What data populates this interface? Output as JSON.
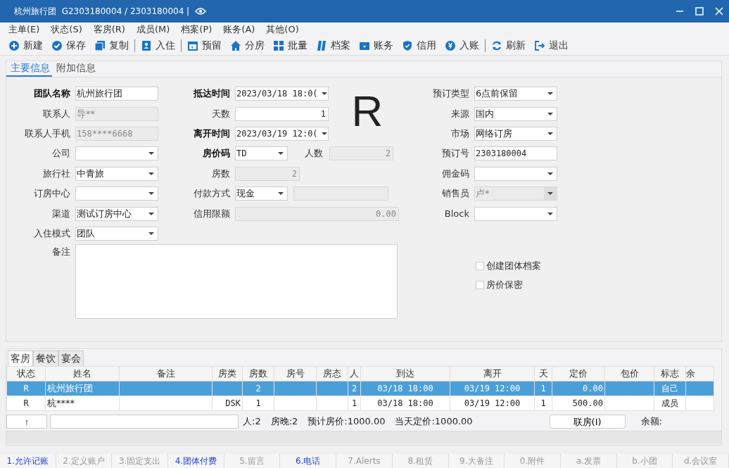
{
  "window": {
    "title": "杭州旅行团  G2303180004 / 2303180004 |"
  },
  "menu": [
    "主单(E)",
    "状态(S)",
    "客房(R)",
    "成员(M)",
    "档案(P)",
    "账务(A)",
    "其他(O)"
  ],
  "toolbar": [
    {
      "kind": "button",
      "label": "新建"
    },
    {
      "kind": "button",
      "label": "保存"
    },
    {
      "kind": "button",
      "label": "复制"
    },
    {
      "kind": "separator"
    },
    {
      "kind": "button",
      "label": "入住"
    },
    {
      "kind": "separator"
    },
    {
      "kind": "button",
      "label": "预留"
    },
    {
      "kind": "button",
      "label": "分房"
    },
    {
      "kind": "button",
      "label": "批量"
    },
    {
      "kind": "button",
      "label": "档案"
    },
    {
      "kind": "button",
      "label": "账务"
    },
    {
      "kind": "button",
      "label": "信用"
    },
    {
      "kind": "button",
      "label": "入账"
    },
    {
      "kind": "separator"
    },
    {
      "kind": "button",
      "label": "刷新"
    },
    {
      "kind": "button",
      "label": "退出"
    }
  ],
  "tabs": [
    {
      "label": "主要信息",
      "selected": true
    },
    {
      "label": "附加信息",
      "selected": false
    }
  ],
  "form": {
    "column_1": [
      {
        "label": "团队名称",
        "value": "杭州旅行团",
        "kind": "text",
        "required": true,
        "disabled": false
      },
      {
        "label": "联系人",
        "value": "导**",
        "kind": "text",
        "required": false,
        "disabled": true
      },
      {
        "label": "联系人手机",
        "value": "158****6668",
        "kind": "text",
        "required": false,
        "disabled": true
      },
      {
        "label": "公司",
        "kind": "select",
        "required": false,
        "disabled": false
      },
      {
        "label": "旅行社",
        "value": "中青旅",
        "kind": "select",
        "required": false,
        "disabled": false
      },
      {
        "label": "订房中心",
        "kind": "select",
        "required": false,
        "disabled": false
      },
      {
        "label": "渠道",
        "value": "测试订房中心",
        "kind": "select",
        "required": false,
        "disabled": false
      },
      {
        "label": "入住模式",
        "value": "团队",
        "kind": "select",
        "required": false,
        "disabled": false
      }
    ],
    "column_2": [
      {
        "label": "抵达时间",
        "value": "2023/03/18 18:0(",
        "kind": "select",
        "required": true,
        "disabled": false
      },
      {
        "label": "天数",
        "value": "1",
        "kind": "number",
        "required": false,
        "disabled": false
      },
      {
        "label": "离开时间",
        "value": "2023/03/19 12:0(",
        "kind": "select",
        "required": true,
        "disabled": false
      },
      {
        "label": "房价码",
        "value": "TD",
        "kind": "select",
        "required": true,
        "disabled": false,
        "extra": {
          "label": "人数",
          "value": "2",
          "kind": "number",
          "disabled": true
        }
      },
      {
        "label": "房数",
        "value": "2",
        "kind": "number",
        "required": false,
        "disabled": true
      },
      {
        "label": "付款方式",
        "value": "现金",
        "kind": "select",
        "required": false,
        "disabled": false,
        "extra": {
          "kind": "text",
          "disabled": true
        }
      },
      {
        "label": "信用限额",
        "value": "0.00",
        "kind": "number",
        "required": false,
        "disabled": true
      }
    ],
    "status_letter": "R",
    "column_3": [
      {
        "label": "预订类型",
        "value": "6点前保留",
        "kind": "select",
        "required": false,
        "disabled": false
      },
      {
        "label": "来源",
        "value": "国内",
        "kind": "select",
        "required": false,
        "disabled": false
      },
      {
        "label": "市场",
        "value": "网络订房",
        "kind": "select",
        "required": false,
        "disabled": false
      },
      {
        "label": "预订号",
        "value": "2303180004",
        "kind": "text",
        "required": false,
        "disabled": false
      },
      {
        "label": "佣金码",
        "kind": "select",
        "required": false,
        "disabled": false
      },
      {
        "label": "销售员",
        "value": "卢*",
        "kind": "select",
        "required": false,
        "disabled": true
      },
      {
        "label": "Block",
        "kind": "select",
        "required": false,
        "disabled": false
      }
    ],
    "remarks": {
      "label": "备注"
    },
    "checkboxes": [
      {
        "label": "创建团体档案",
        "checked": false
      },
      {
        "label": "房价保密",
        "checked": false
      }
    ]
  },
  "bottom_tabs": [
    {
      "label": "客房",
      "selected": true
    },
    {
      "label": "餐饮",
      "selected": false
    },
    {
      "label": "宴会",
      "selected": false
    }
  ],
  "table": {
    "columns": [
      "状态",
      "姓名",
      "备注",
      "房类",
      "房数",
      "房号",
      "房态",
      "人",
      "到达",
      "离开",
      "天",
      "定价",
      "包价",
      "标志",
      "余"
    ],
    "rows": [
      {
        "selected": true,
        "cells": [
          "R",
          "杭州旅行团",
          "",
          "",
          "2",
          "",
          "",
          "2",
          "03/18 18:00",
          "03/19 12:00",
          "1",
          "0.00",
          "",
          "自己",
          ""
        ]
      },
      {
        "selected": false,
        "cells": [
          "R",
          "杭****",
          "",
          "DSK",
          "1",
          "",
          "",
          "1",
          "03/18 18:00",
          "03/19 12:00",
          "1",
          "500.00",
          "",
          "成员",
          ""
        ]
      }
    ]
  },
  "footer": {
    "up_button": "↑",
    "summary": [
      "人:2",
      "房晚:2",
      "预计房价:1000.00",
      "当天定价:1000.00"
    ],
    "link_button": "联房(I)",
    "balance_label": "余额:"
  },
  "function_bar": [
    {
      "label": "1.允许记账",
      "enabled": true
    },
    {
      "label": "2.定义账户",
      "enabled": false
    },
    {
      "label": "3.固定支出",
      "enabled": false
    },
    {
      "label": "4.团体付费",
      "enabled": true
    },
    {
      "label": "5.留言",
      "enabled": false
    },
    {
      "label": "6.电话",
      "enabled": true
    },
    {
      "label": "7.Alerts",
      "enabled": false
    },
    {
      "label": "8.租赁",
      "enabled": false
    },
    {
      "label": "9.大备注",
      "enabled": false
    },
    {
      "label": "0.附件",
      "enabled": false
    },
    {
      "label": "a.发票",
      "enabled": false
    },
    {
      "label": "b.小团",
      "enabled": false
    },
    {
      "label": "d.会议室",
      "enabled": false
    }
  ]
}
